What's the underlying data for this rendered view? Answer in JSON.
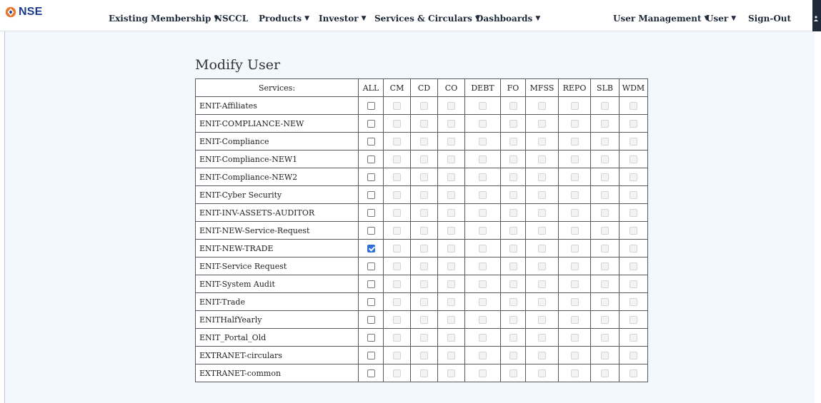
{
  "nav": {
    "logo_text": "NSE",
    "items": [
      {
        "label": "Existing Membership",
        "dropdown": true
      },
      {
        "label": "NSCCL",
        "dropdown": false
      },
      {
        "label": "Products",
        "dropdown": true
      },
      {
        "label": "Investor",
        "dropdown": true
      },
      {
        "label": "Services & Circulars",
        "dropdown": true
      },
      {
        "label": "Dashboards",
        "dropdown": true
      }
    ],
    "right_items": [
      {
        "label": "User Management",
        "dropdown": true
      },
      {
        "label": "User",
        "dropdown": true
      },
      {
        "label": "Sign-Out",
        "dropdown": false
      }
    ],
    "caret": "▼"
  },
  "page": {
    "title": "Modify User"
  },
  "table": {
    "headers": [
      "Services:",
      "ALL",
      "CM",
      "CD",
      "CO",
      "DEBT",
      "FO",
      "MFSS",
      "REPO",
      "SLB",
      "WDM"
    ],
    "rows": [
      {
        "name": "ENIT-Affiliates",
        "all_checked": false
      },
      {
        "name": "ENIT-COMPLIANCE-NEW",
        "all_checked": false
      },
      {
        "name": "ENIT-Compliance",
        "all_checked": false
      },
      {
        "name": "ENIT-Compliance-NEW1",
        "all_checked": false
      },
      {
        "name": "ENIT-Compliance-NEW2",
        "all_checked": false
      },
      {
        "name": "ENIT-Cyber Security",
        "all_checked": false
      },
      {
        "name": "ENIT-INV-ASSETS-AUDITOR",
        "all_checked": false
      },
      {
        "name": "ENIT-NEW-Service-Request",
        "all_checked": false
      },
      {
        "name": "ENIT-NEW-TRADE",
        "all_checked": true
      },
      {
        "name": "ENIT-Service Request",
        "all_checked": false
      },
      {
        "name": "ENIT-System Audit",
        "all_checked": false
      },
      {
        "name": "ENIT-Trade",
        "all_checked": false
      },
      {
        "name": "ENITHalfYearly",
        "all_checked": false
      },
      {
        "name": "ENIT_Portal_Old",
        "all_checked": false
      },
      {
        "name": "EXTRANET-circulars",
        "all_checked": false
      },
      {
        "name": "EXTRANET-common",
        "all_checked": false
      }
    ]
  },
  "colors": {
    "background": "#f2f8fd",
    "accent": "#2f6fd6",
    "logo_orange": "#e8772e",
    "logo_blue": "#1d3b8e"
  },
  "icons": {
    "logo": "nse-logo-icon",
    "user": "user-icon"
  }
}
